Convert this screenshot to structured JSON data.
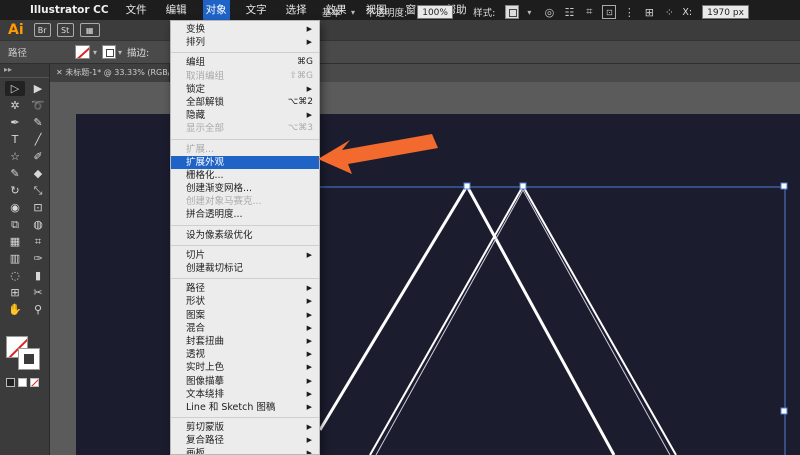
{
  "menubar": {
    "apple": "",
    "app_name": "Illustrator CC",
    "items": [
      "文件",
      "编辑",
      "对象",
      "文字",
      "选择",
      "效果",
      "视图",
      "窗口",
      "帮助"
    ],
    "active_item": "对象"
  },
  "appbar": {
    "logo": "Ai",
    "buttons": [
      "Br",
      "St"
    ]
  },
  "control_bar": {
    "label": "路径",
    "stroke_label": "描边:",
    "basic_label": "基本",
    "opacity_label": "不透明度:",
    "opacity_value": "100%",
    "style_label": "样式:",
    "x_label": "X:",
    "x_value": "1970 px"
  },
  "document_tab": {
    "title": "未标题-1* @ 33.33% (RGB/GPU"
  },
  "menu": {
    "groups": [
      [
        {
          "label": "变换",
          "submenu": true
        },
        {
          "label": "排列",
          "submenu": true
        }
      ],
      [
        {
          "label": "编组",
          "shortcut": "⌘G"
        },
        {
          "label": "取消编组",
          "shortcut": "⇧⌘G",
          "disabled": true
        },
        {
          "label": "锁定",
          "submenu": true
        },
        {
          "label": "全部解锁",
          "shortcut": "⌥⌘2"
        },
        {
          "label": "隐藏",
          "submenu": true
        },
        {
          "label": "显示全部",
          "shortcut": "⌥⌘3",
          "disabled": true
        }
      ],
      [
        {
          "label": "扩展...",
          "disabled": true
        },
        {
          "label": "扩展外观",
          "highlighted": true
        },
        {
          "label": "栅格化..."
        },
        {
          "label": "创建渐变网格..."
        },
        {
          "label": "创建对象马赛克...",
          "disabled": true
        },
        {
          "label": "拼合透明度..."
        }
      ],
      [
        {
          "label": "设为像素级优化"
        }
      ],
      [
        {
          "label": "切片",
          "submenu": true
        },
        {
          "label": "创建裁切标记"
        }
      ],
      [
        {
          "label": "路径",
          "submenu": true
        },
        {
          "label": "形状",
          "submenu": true
        },
        {
          "label": "图案",
          "submenu": true
        },
        {
          "label": "混合",
          "submenu": true
        },
        {
          "label": "封套扭曲",
          "submenu": true
        },
        {
          "label": "透视",
          "submenu": true
        },
        {
          "label": "实时上色",
          "submenu": true
        },
        {
          "label": "图像描摹",
          "submenu": true
        },
        {
          "label": "文本绕排",
          "submenu": true
        },
        {
          "label": "Line 和 Sketch 图稿",
          "submenu": true
        }
      ],
      [
        {
          "label": "剪切蒙版",
          "submenu": true
        },
        {
          "label": "复合路径",
          "submenu": true
        },
        {
          "label": "画板",
          "submenu": true
        }
      ]
    ]
  },
  "colors": {
    "highlight": "#1f63c7",
    "arrow": "#f26a2e",
    "artboard": "#1b1c2e",
    "logo": "#ff9a00"
  },
  "icons": {
    "submenu_arrow": "▶"
  }
}
